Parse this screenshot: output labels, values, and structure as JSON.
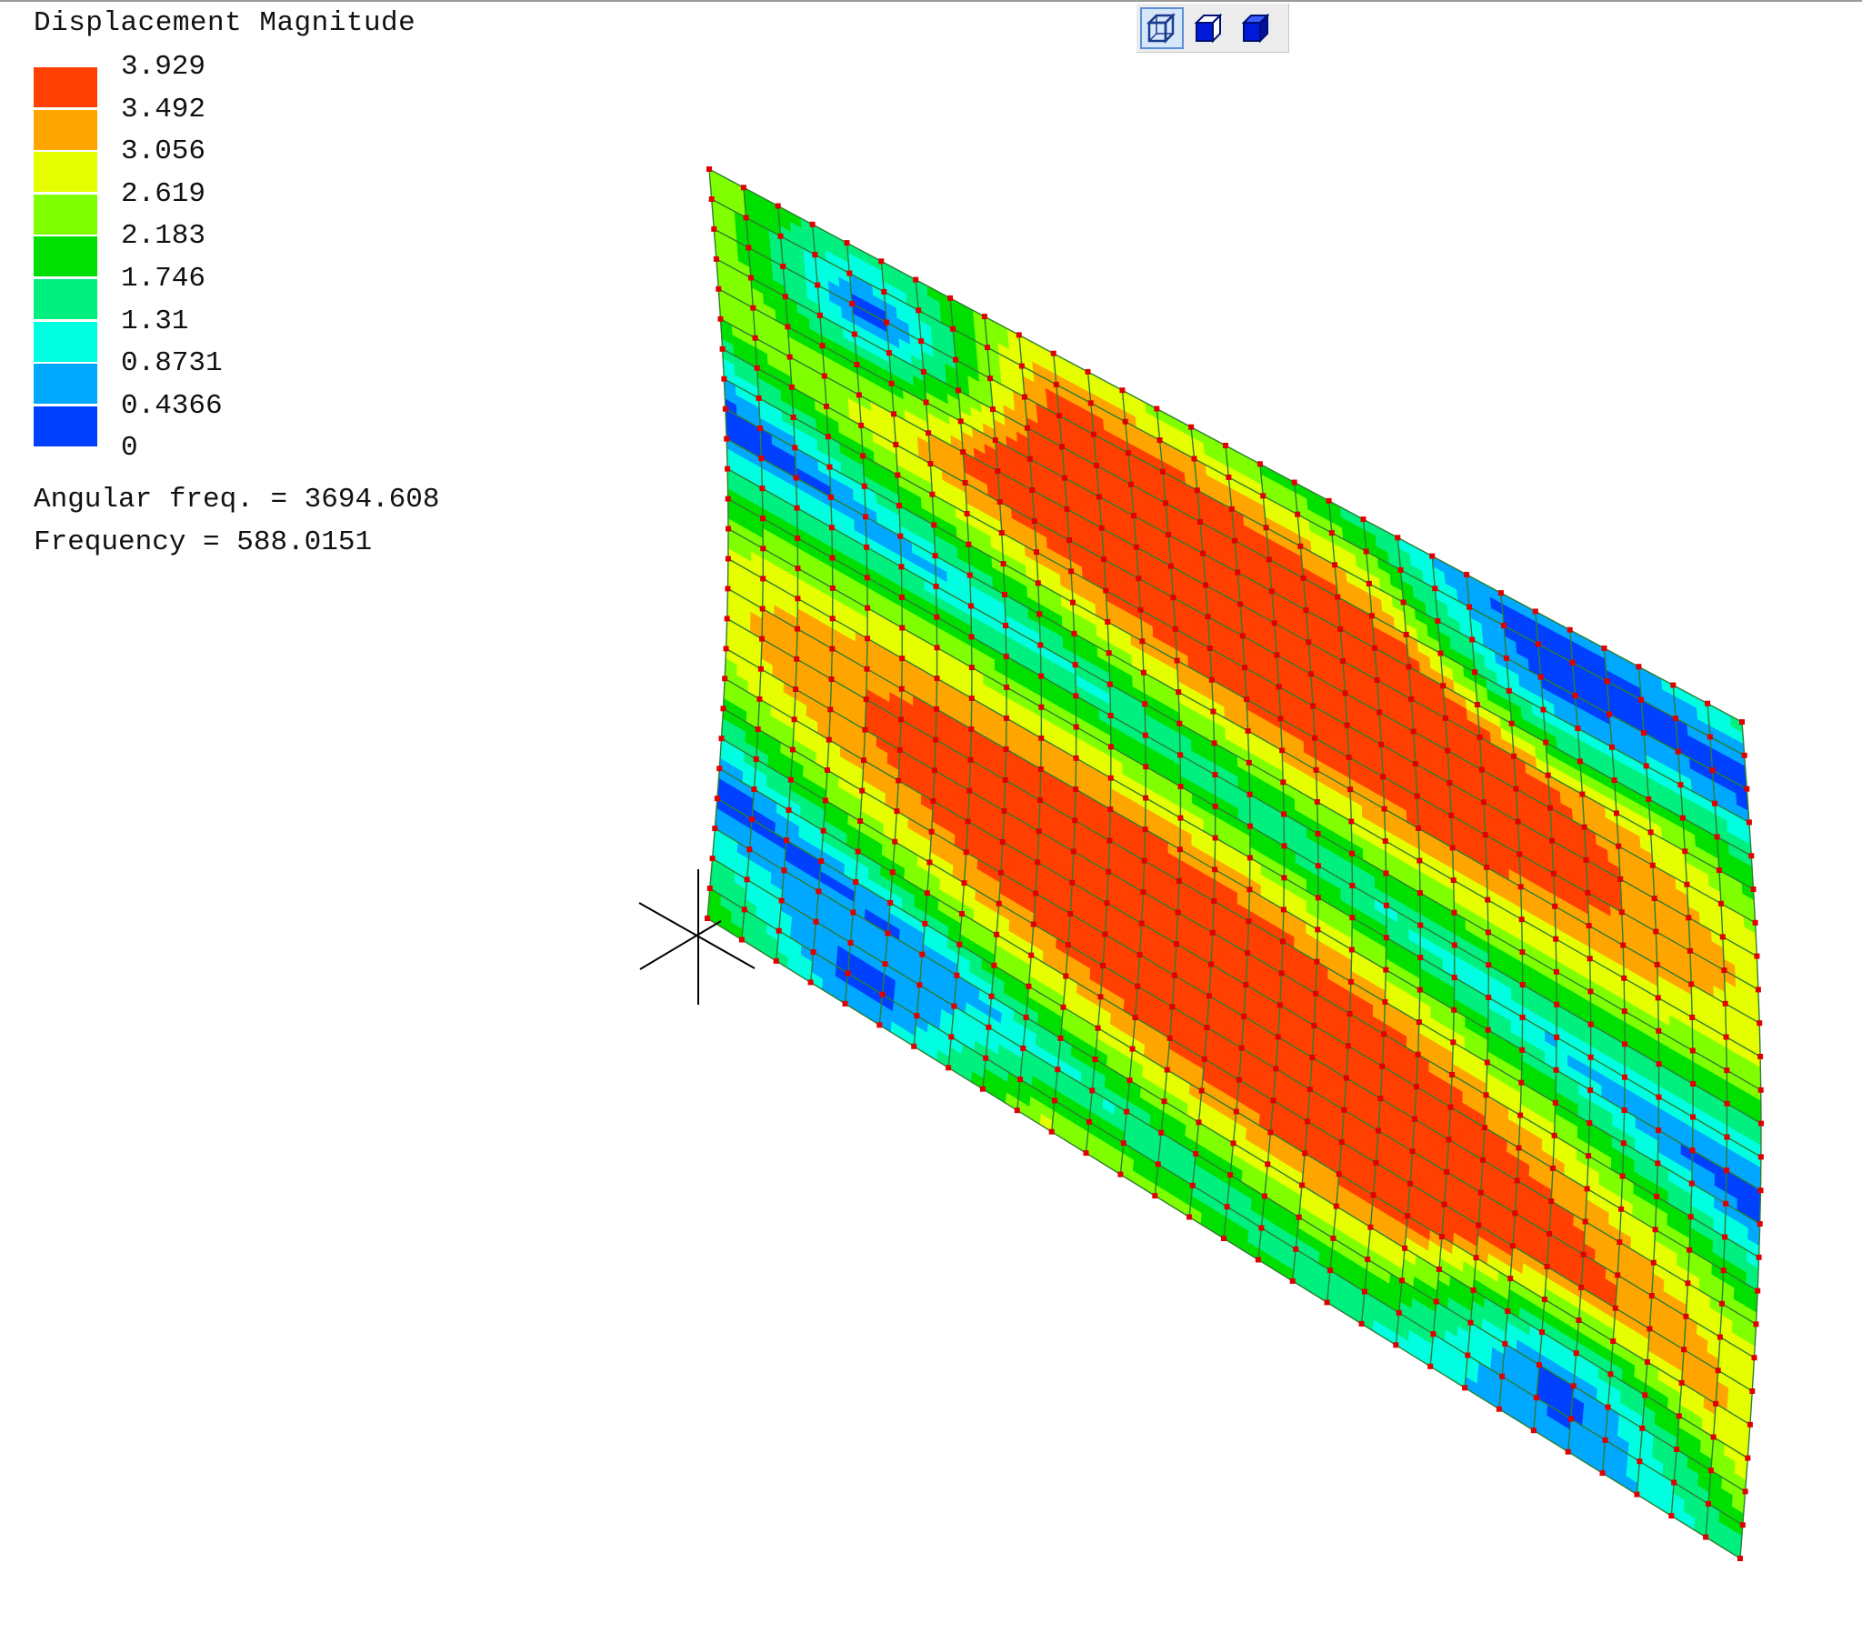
{
  "legend": {
    "title": "Displacement Magnitude",
    "levels": [
      {
        "value": "3.929",
        "color": "#ff4000"
      },
      {
        "value": "3.492",
        "color": "#ffa500"
      },
      {
        "value": "3.056",
        "color": "#e6ff00"
      },
      {
        "value": "2.619",
        "color": "#80ff00"
      },
      {
        "value": "2.183",
        "color": "#00e000"
      },
      {
        "value": "1.746",
        "color": "#00f080"
      },
      {
        "value": "1.31",
        "color": "#00ffe0"
      },
      {
        "value": "0.8731",
        "color": "#00a8ff"
      },
      {
        "value": "0.4366",
        "color": "#0040ff"
      },
      {
        "value": "0",
        "color": null
      }
    ]
  },
  "info": {
    "angular_freq": "Angular freq. = 3694.608",
    "frequency": "Frequency = 588.0151"
  },
  "toolbar": {
    "buttons": [
      {
        "icon": "wireframe-cube-icon",
        "active": true
      },
      {
        "icon": "hidden-line-cube-icon",
        "active": false
      },
      {
        "icon": "solid-cube-icon",
        "active": false
      }
    ]
  },
  "mesh": {
    "columns": 30,
    "rows": 25,
    "line_color": "#2e7d32",
    "node_color": "#e00000"
  }
}
